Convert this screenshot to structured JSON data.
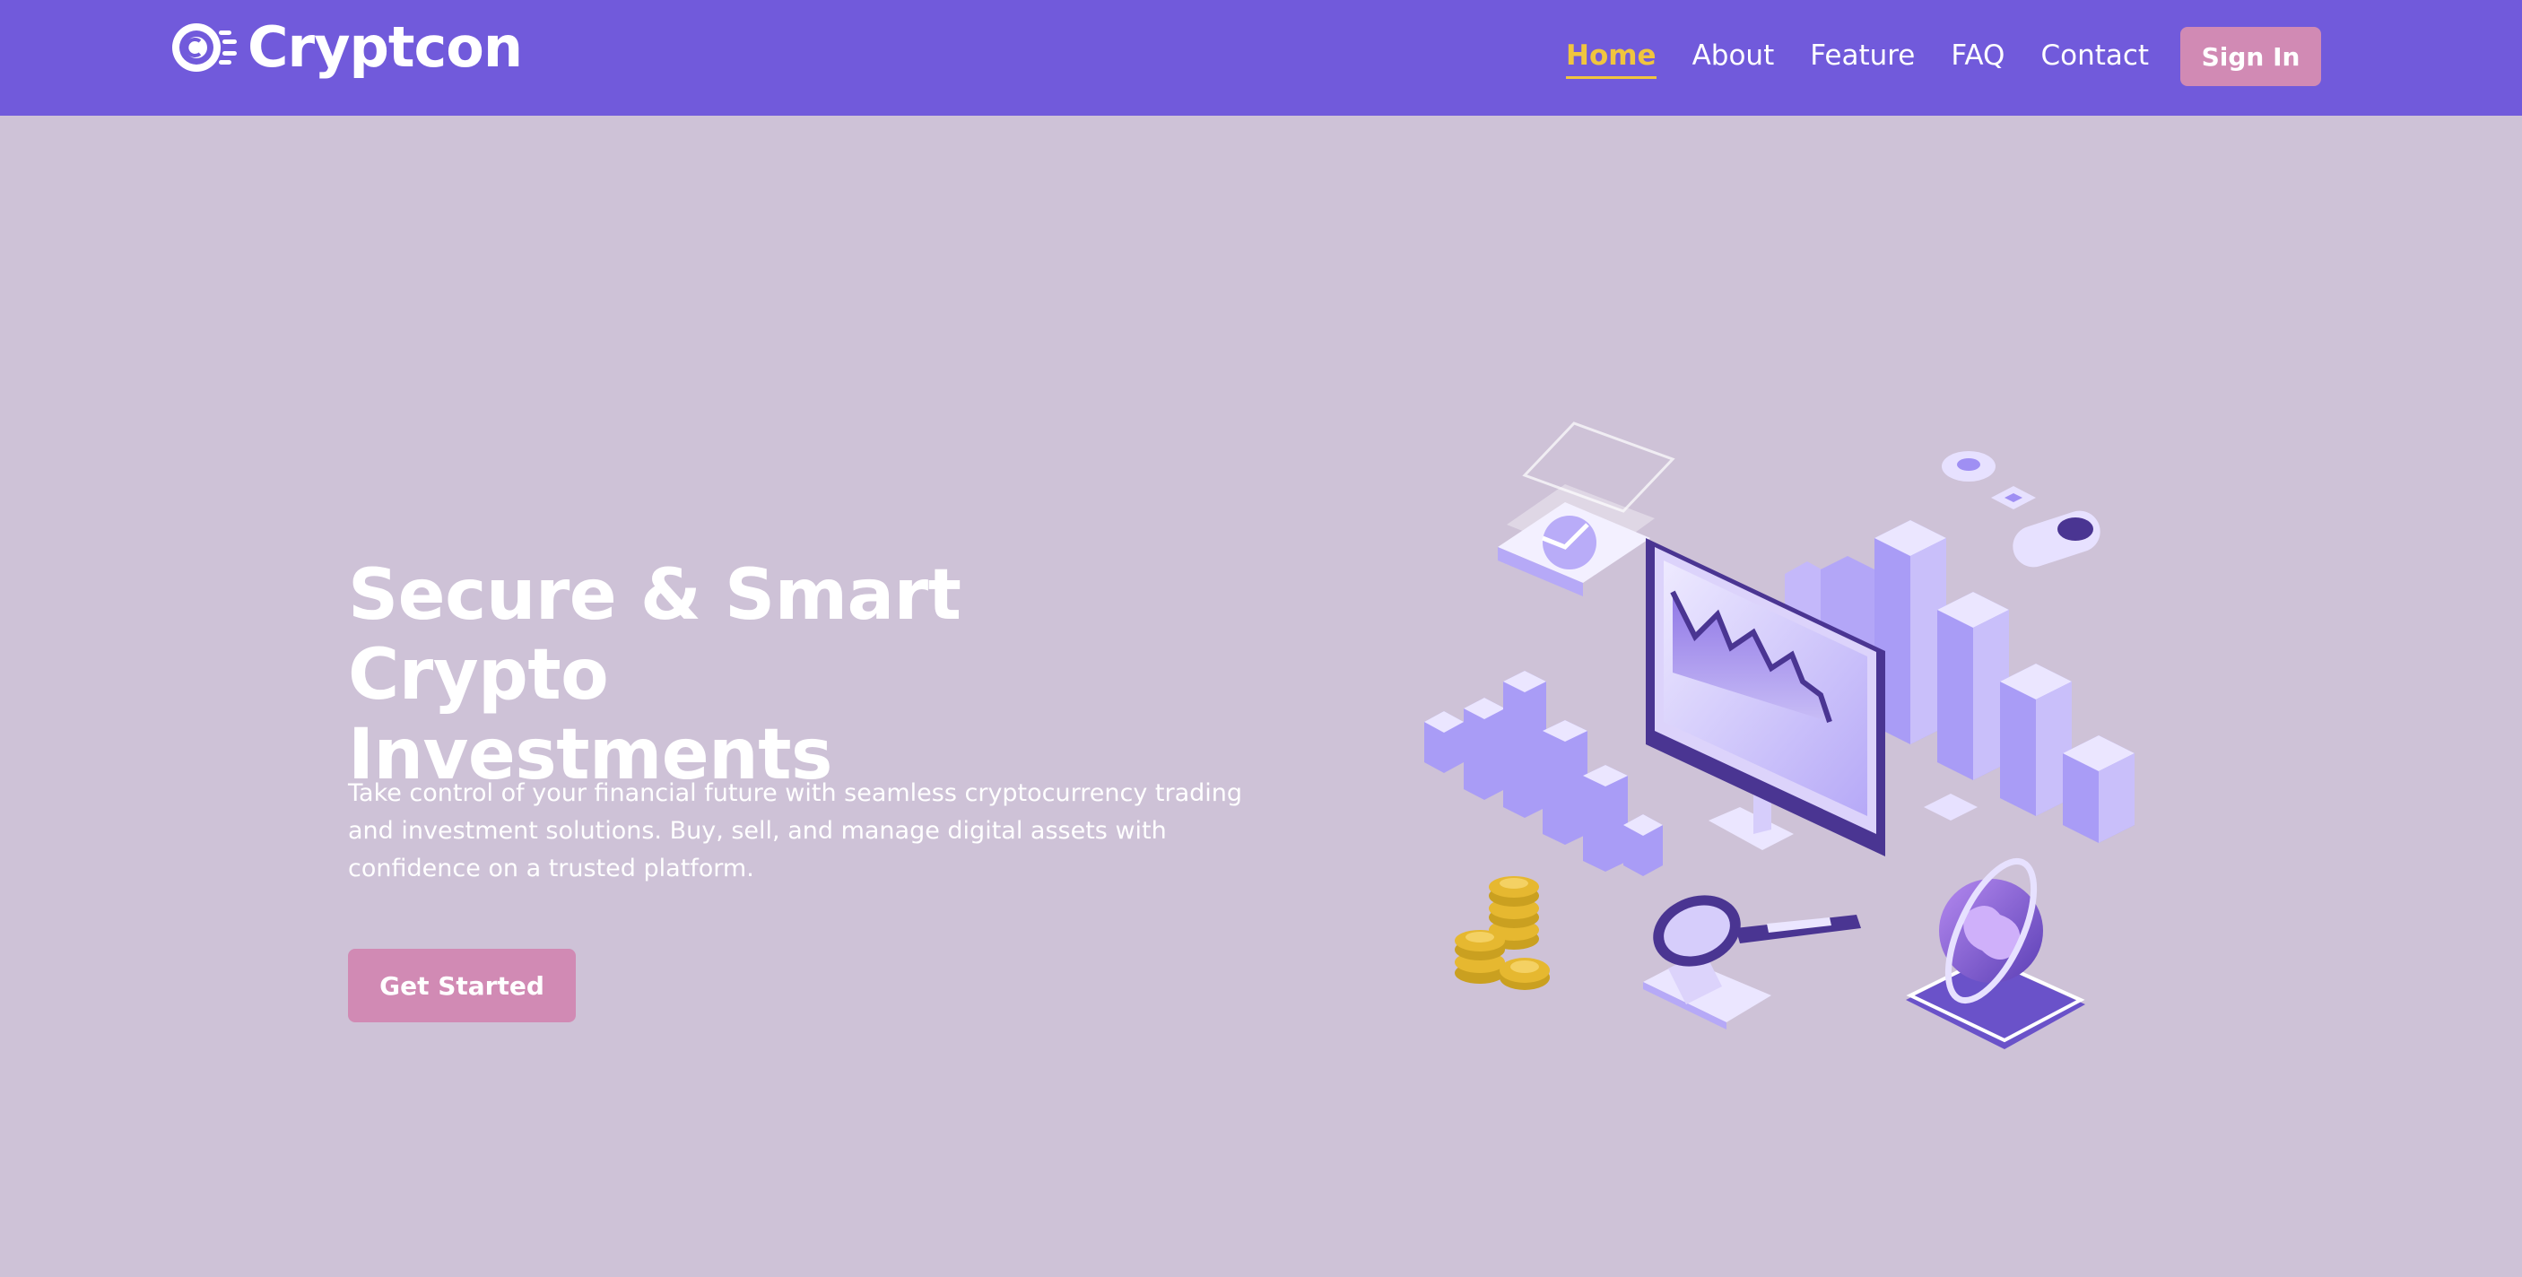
{
  "brand": {
    "name": "Cryptcon",
    "logo_icon": "crypto-coin-icon"
  },
  "nav": {
    "links": [
      "Home",
      "About",
      "Feature",
      "FAQ",
      "Contact"
    ],
    "active": "Home",
    "signin_label": "Sign In"
  },
  "hero": {
    "title_line1": "Secure & Smart Crypto",
    "title_line2": "Investments",
    "description_line1": "Take control of your financial future with seamless cryptocurrency trading",
    "description_line2": "and investment solutions. Buy, sell, and manage digital assets with",
    "description_line3": "confidence on a trusted platform.",
    "cta_label": "Get Started",
    "illustration": "isometric-crypto-dashboard-illustration"
  },
  "colors": {
    "navbar_bg": "#715adb",
    "page_bg": "#cec2d7",
    "accent_active": "#f0c53e",
    "button_bg": "#d18ab4",
    "text": "#ffffff",
    "illustration_primary": "#a99cf6",
    "illustration_dark": "#4a3592",
    "coin_gold": "#e6b830"
  }
}
